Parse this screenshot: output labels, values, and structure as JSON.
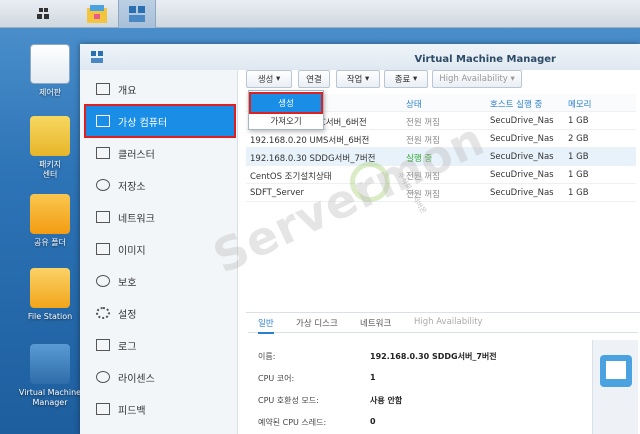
{
  "taskbar": {
    "items": [
      "main-menu-icon",
      "package-center-icon",
      "vmm-icon"
    ]
  },
  "desktop": {
    "icons": [
      {
        "label": "제어판",
        "icon": "control-panel-icon"
      },
      {
        "label": "패키지\n센터",
        "icon": "package-center-icon"
      },
      {
        "label": "공유 폴더",
        "icon": "shared-folder-icon"
      },
      {
        "label": "File Station",
        "icon": "file-station-icon"
      },
      {
        "label": "Virtual Machine\nManager",
        "icon": "vmm-icon"
      }
    ]
  },
  "window": {
    "title": "Virtual Machine Manager"
  },
  "sidebar": {
    "items": [
      {
        "label": "개요"
      },
      {
        "label": "가상 컴퓨터"
      },
      {
        "label": "클러스터"
      },
      {
        "label": "저장소"
      },
      {
        "label": "네트워크"
      },
      {
        "label": "이미지"
      },
      {
        "label": "보호"
      },
      {
        "label": "설정"
      },
      {
        "label": "로그"
      },
      {
        "label": "라이센스"
      },
      {
        "label": "피드백"
      }
    ]
  },
  "toolbar": {
    "create": "생성",
    "connect": "연결",
    "action": "작업",
    "shutdown": "종료",
    "ha": "High Availability"
  },
  "dropdown": {
    "create": "생성",
    "import": "가져오기"
  },
  "table": {
    "headers": [
      "",
      "상태",
      "호스트 실행 중",
      "메모리"
    ],
    "rows": [
      {
        "name": "",
        "status": "",
        "host": "",
        "memory": ""
      },
      {
        "name": "192.168.0.20 SFC서버_6버전",
        "status": "전원 꺼짐",
        "host": "SecuDrive_Nas",
        "memory": "1 GB"
      },
      {
        "name": "192.168.0.20 UMS서버_6버전",
        "status": "전원 꺼짐",
        "host": "SecuDrive_Nas",
        "memory": "2 GB"
      },
      {
        "name": "192.168.0.30 SDDG서버_7버전",
        "status": "실행 중",
        "host": "SecuDrive_Nas",
        "memory": "1 GB"
      },
      {
        "name": "CentOS 조기설치상태",
        "status": "전원 꺼짐",
        "host": "SecuDrive_Nas",
        "memory": "1 GB"
      },
      {
        "name": "SDFT_Server",
        "status": "전원 꺼짐",
        "host": "SecuDrive_Nas",
        "memory": "1 GB"
      }
    ]
  },
  "detail": {
    "tabs": [
      "일반",
      "가상 디스크",
      "네트워크",
      "High Availability"
    ],
    "props": [
      {
        "label": "이름:",
        "value": "192.168.0.30 SDDG서버_7버전"
      },
      {
        "label": "CPU 코어:",
        "value": "1"
      },
      {
        "label": "CPU 호환성 모드:",
        "value": "사용 안함"
      },
      {
        "label": "예약된 CPU 스레드:",
        "value": "0"
      }
    ]
  },
  "watermark": {
    "text": "Servermon",
    "sub": "주식회사 서버몬"
  },
  "colors": {
    "accent": "#1a8ee6",
    "highlight": "#e02020",
    "running": "#2aa52a"
  }
}
